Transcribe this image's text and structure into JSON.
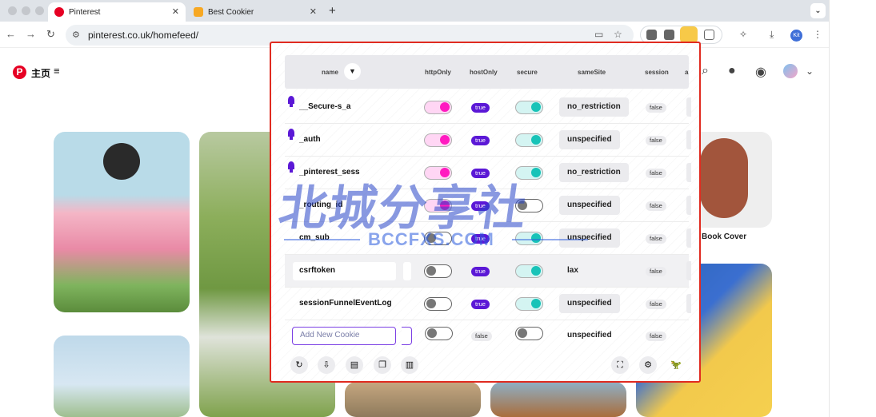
{
  "browser": {
    "tabs": [
      {
        "title": "Pinterest",
        "favicon_color": "#e60023",
        "active": true
      },
      {
        "title": "Best Cookier",
        "favicon_color": "#f7a823",
        "active": false
      }
    ],
    "new_tab_label": "+",
    "tab_close": "✕",
    "url": "pinterest.co.uk/homefeed/",
    "profile_initials": "Kit"
  },
  "pinterest": {
    "home_label": "主页",
    "caption": "Book Cover"
  },
  "cookie_editor": {
    "columns": {
      "name": "name",
      "httpOnly": "httpOnly",
      "hostOnly": "hostOnly",
      "secure": "secure",
      "sameSite": "sameSite",
      "session": "session",
      "overflow": "a"
    },
    "rows": [
      {
        "name": "__Secure-s_a",
        "pinned": true,
        "httpOnly": true,
        "hostOnly": "true",
        "secure": true,
        "sameSite": "no_restriction",
        "session": "false"
      },
      {
        "name": "_auth",
        "pinned": true,
        "httpOnly": true,
        "hostOnly": "true",
        "secure": true,
        "sameSite": "unspecified",
        "session": "false"
      },
      {
        "name": "_pinterest_sess",
        "pinned": true,
        "httpOnly": true,
        "hostOnly": "true",
        "secure": true,
        "sameSite": "no_restriction",
        "session": "false"
      },
      {
        "name": "_routing_id",
        "pinned": false,
        "httpOnly": true,
        "hostOnly": "true",
        "secure": false,
        "sameSite": "unspecified",
        "session": "false"
      },
      {
        "name": "cm_sub",
        "pinned": false,
        "httpOnly": false,
        "hostOnly": "true",
        "secure": true,
        "sameSite": "unspecified",
        "session": "false"
      },
      {
        "name": "csrftoken",
        "pinned": false,
        "httpOnly": false,
        "hostOnly": "true",
        "secure": true,
        "sameSite": "lax",
        "session": "false"
      },
      {
        "name": "sessionFunnelEventLog",
        "pinned": false,
        "httpOnly": false,
        "hostOnly": "true",
        "secure": true,
        "sameSite": "unspecified",
        "session": "false"
      }
    ],
    "new_row": {
      "placeholder": "Add New Cookie",
      "httpOnly": false,
      "hostOnly": "false",
      "secure": false,
      "sameSite": "unspecified",
      "session": "false"
    },
    "colors": {
      "accent": "#5b18d6",
      "pink": "#ff1ac0",
      "teal": "#18c3b8",
      "frame": "#e02b20"
    }
  },
  "watermark": {
    "big": "北城分享社",
    "small": "BCCFXS.COM"
  }
}
